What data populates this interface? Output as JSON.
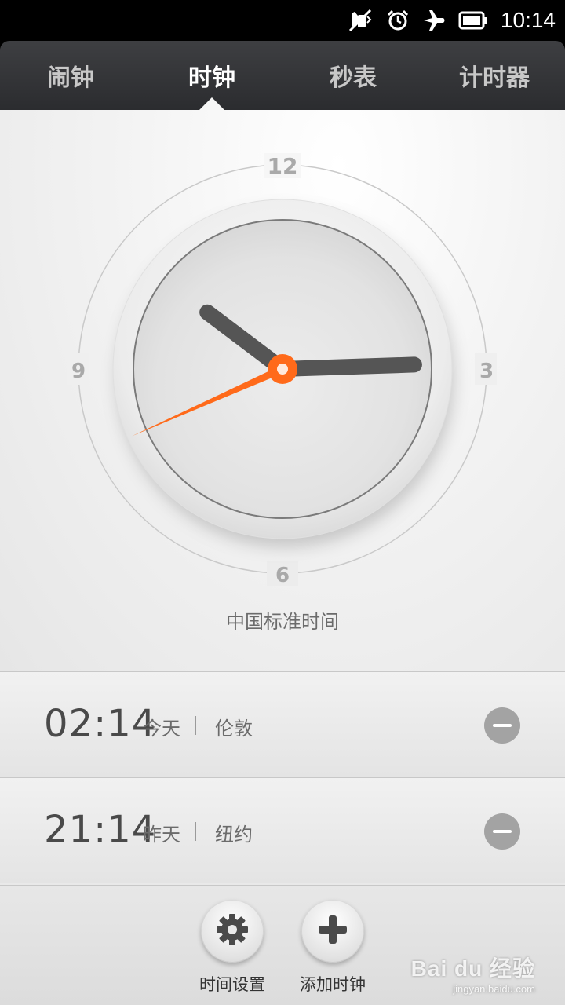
{
  "status_bar": {
    "icons": [
      "vibrate-off-icon",
      "alarm-icon",
      "airplane-mode-icon",
      "battery-icon"
    ],
    "time": "10:14"
  },
  "tabs": [
    {
      "label": "闹钟",
      "active": false
    },
    {
      "label": "时钟",
      "active": true
    },
    {
      "label": "秒表",
      "active": false
    },
    {
      "label": "计时器",
      "active": false
    }
  ],
  "clock": {
    "numerals": {
      "twelve": "12",
      "three": "3",
      "six": "6",
      "nine": "9"
    },
    "time": {
      "hour": 10,
      "minute": 14,
      "second": 41
    },
    "accent_color": "#ff6a1a",
    "timezone_label": "中国标准时间"
  },
  "world_clocks": [
    {
      "time": "02:14",
      "day": "今天",
      "city": "伦敦"
    },
    {
      "time": "21:14",
      "day": "昨天",
      "city": "纽约"
    }
  ],
  "actions": {
    "settings_label": "时间设置",
    "add_label": "添加时钟"
  },
  "watermark": {
    "main": "Bai du 经验",
    "sub": "jingyan.baidu.com"
  }
}
